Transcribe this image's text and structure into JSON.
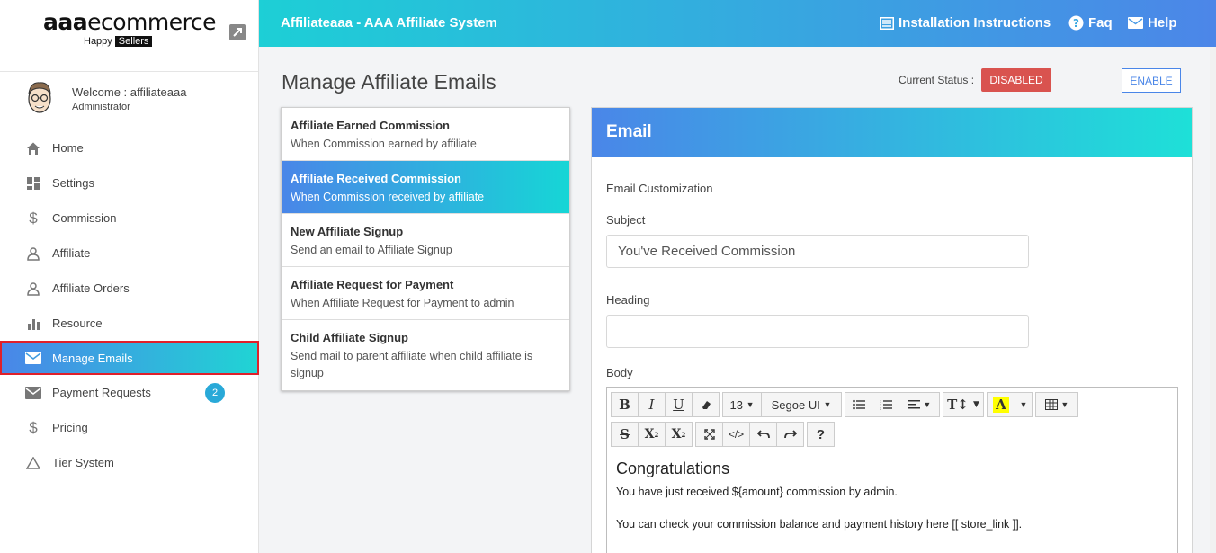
{
  "brand": {
    "name_bold": "aaa",
    "name_rest": "ecommerce",
    "tag_a": "Happy",
    "tag_b": "Sellers"
  },
  "user": {
    "welcome": "Welcome : affiliateaaa",
    "role": "Administrator"
  },
  "nav": [
    {
      "label": "Home",
      "icon": "home-icon"
    },
    {
      "label": "Settings",
      "icon": "dashboard-icon"
    },
    {
      "label": "Commission",
      "icon": "dollar-icon"
    },
    {
      "label": "Affiliate",
      "icon": "user-icon"
    },
    {
      "label": "Affiliate Orders",
      "icon": "user-icon"
    },
    {
      "label": "Resource",
      "icon": "bar-chart-icon"
    },
    {
      "label": "Manage Emails",
      "icon": "mail-icon",
      "active": true
    },
    {
      "label": "Payment Requests",
      "icon": "mail-icon",
      "badge": "2"
    },
    {
      "label": "Pricing",
      "icon": "dollar-icon"
    },
    {
      "label": "Tier System",
      "icon": "triangle-icon"
    }
  ],
  "topbar": {
    "title": "Affiliateaaa - AAA Affiliate System",
    "install": "Installation Instructions",
    "faq": "Faq",
    "help": "Help"
  },
  "page": {
    "title": "Manage Affiliate Emails",
    "status_label": "Current Status :",
    "status_value": "DISABLED",
    "enable": "ENABLE"
  },
  "emails": [
    {
      "title": "Affiliate Earned Commission",
      "desc": "When Commission earned by affiliate"
    },
    {
      "title": "Affiliate Received Commission",
      "desc": "When Commission received by affiliate",
      "active": true
    },
    {
      "title": "New Affiliate Signup",
      "desc": "Send an email to Affiliate Signup"
    },
    {
      "title": "Affiliate Request for Payment",
      "desc": "When Affiliate Request for Payment to admin"
    },
    {
      "title": "Child Affiliate Signup",
      "desc": "Send mail to parent affiliate when child affiliate is signup"
    }
  ],
  "panel": {
    "title": "Email",
    "section": "Email Customization",
    "subject_label": "Subject",
    "subject_value": "You've Received Commission",
    "heading_label": "Heading",
    "heading_value": "",
    "body_label": "Body"
  },
  "editor": {
    "font_size": "13",
    "font_name": "Segoe UI",
    "heading": "Congratulations",
    "line1": "You have just received ${amount} commission by admin.",
    "line2": "You can check your commission balance and payment history here [[ store_link ]]."
  },
  "colors": {
    "accent_blue": "#4a86e8",
    "accent_teal": "#1ee0d8",
    "danger": "#d9534f",
    "badge": "#29a9d8"
  }
}
